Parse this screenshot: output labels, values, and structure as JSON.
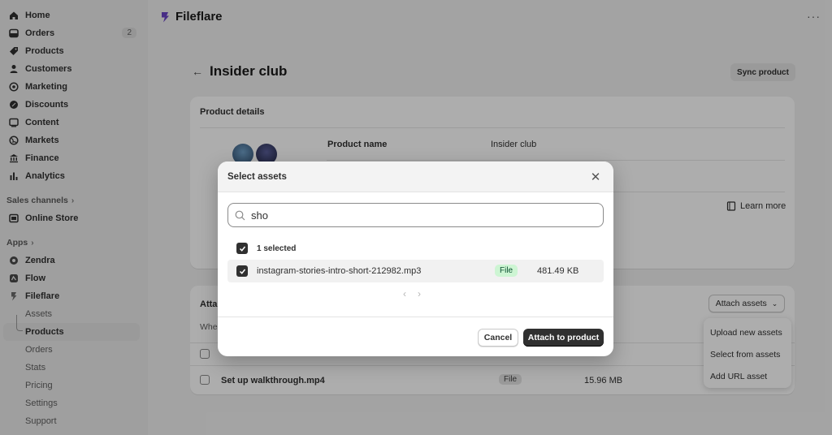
{
  "sidebar": {
    "items": [
      {
        "label": "Home",
        "icon": "home-icon"
      },
      {
        "label": "Orders",
        "icon": "orders-icon",
        "badge": "2"
      },
      {
        "label": "Products",
        "icon": "tag-icon"
      },
      {
        "label": "Customers",
        "icon": "person-icon"
      },
      {
        "label": "Marketing",
        "icon": "target-icon"
      },
      {
        "label": "Discounts",
        "icon": "discount-icon"
      },
      {
        "label": "Content",
        "icon": "content-icon"
      },
      {
        "label": "Markets",
        "icon": "globe-icon"
      },
      {
        "label": "Finance",
        "icon": "bank-icon"
      },
      {
        "label": "Analytics",
        "icon": "bar-chart-icon"
      }
    ],
    "sales_channels_label": "Sales channels",
    "online_store_label": "Online Store",
    "apps_label": "Apps",
    "apps": [
      {
        "label": "Zendra"
      },
      {
        "label": "Flow"
      },
      {
        "label": "Fileflare"
      }
    ],
    "fileflare_sub": [
      "Assets",
      "Products",
      "Orders",
      "Stats",
      "Pricing",
      "Settings",
      "Support"
    ]
  },
  "header": {
    "app_title": "Fileflare"
  },
  "page": {
    "title": "Insider club",
    "sync_button": "Sync product",
    "product_details_title": "Product details",
    "product_name_label": "Product name",
    "product_name_value": "Insider club",
    "learn_more": "Learn more",
    "attachments_title": "Atta",
    "attachments_desc": "Whe",
    "attach_assets_button": "Attach assets",
    "existing_file": {
      "name": "Set up walkthrough.mp4",
      "type": "File",
      "size": "15.96 MB"
    },
    "dropdown": [
      "Upload new assets",
      "Select from assets",
      "Add URL asset"
    ]
  },
  "modal": {
    "title": "Select assets",
    "search_value": "sho",
    "selected_count": "1 selected",
    "file": {
      "name": "instagram-stories-intro-short-212982.mp3",
      "type": "File",
      "size": "481.49 KB"
    },
    "cancel_label": "Cancel",
    "primary_label": "Attach to product"
  },
  "colors": {
    "primary": "#303030",
    "badge_green_bg": "#cdf5d3",
    "badge_green_text": "#0c5132"
  }
}
